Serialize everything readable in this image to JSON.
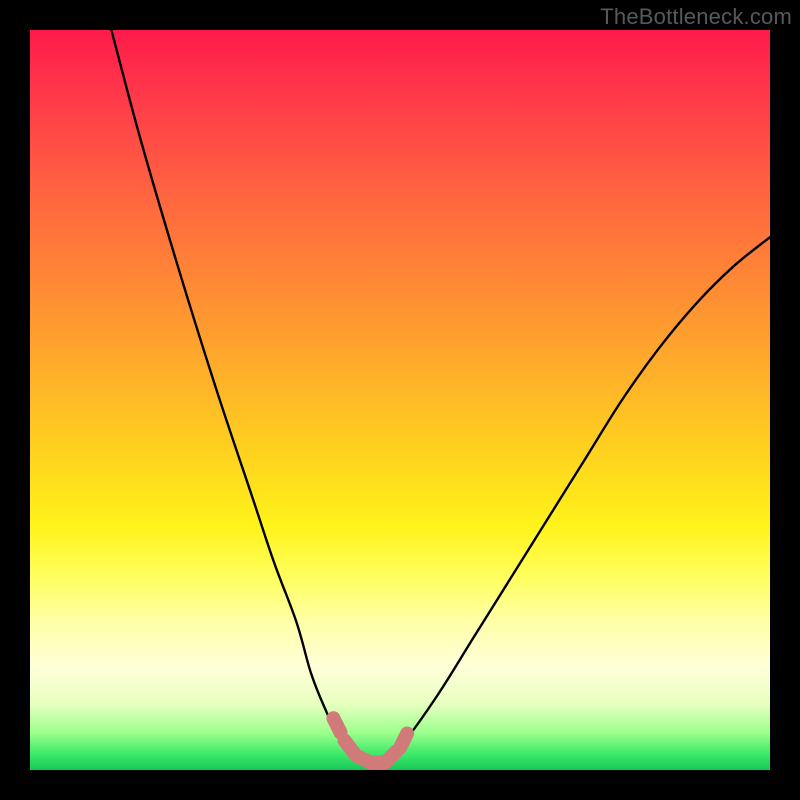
{
  "watermark": "TheBottleneck.com",
  "chart_data": {
    "type": "line",
    "title": "",
    "xlabel": "",
    "ylabel": "",
    "xlim": [
      0,
      100
    ],
    "ylim": [
      0,
      100
    ],
    "series": [
      {
        "name": "curve",
        "x": [
          11,
          15,
          20,
          25,
          30,
          33,
          36,
          38,
          40,
          42,
          44,
          46,
          48,
          50,
          55,
          60,
          65,
          70,
          75,
          80,
          85,
          90,
          95,
          100
        ],
        "values": [
          100,
          85,
          68,
          52,
          37,
          28,
          20,
          13,
          8,
          4,
          2,
          1,
          1,
          3,
          10,
          18,
          26,
          34,
          42,
          50,
          57,
          63,
          68,
          72
        ]
      }
    ],
    "annotations": [
      {
        "name": "bottom-dash",
        "x": [
          41,
          42.5,
          44,
          46,
          48,
          50,
          51.5
        ],
        "y": [
          7,
          4,
          2,
          1,
          1,
          3,
          6
        ],
        "color": "#d17a7a"
      }
    ],
    "background_gradient": {
      "top": "#ff1a4b",
      "mid": "#ffd21f",
      "bottom": "#18c858"
    }
  }
}
